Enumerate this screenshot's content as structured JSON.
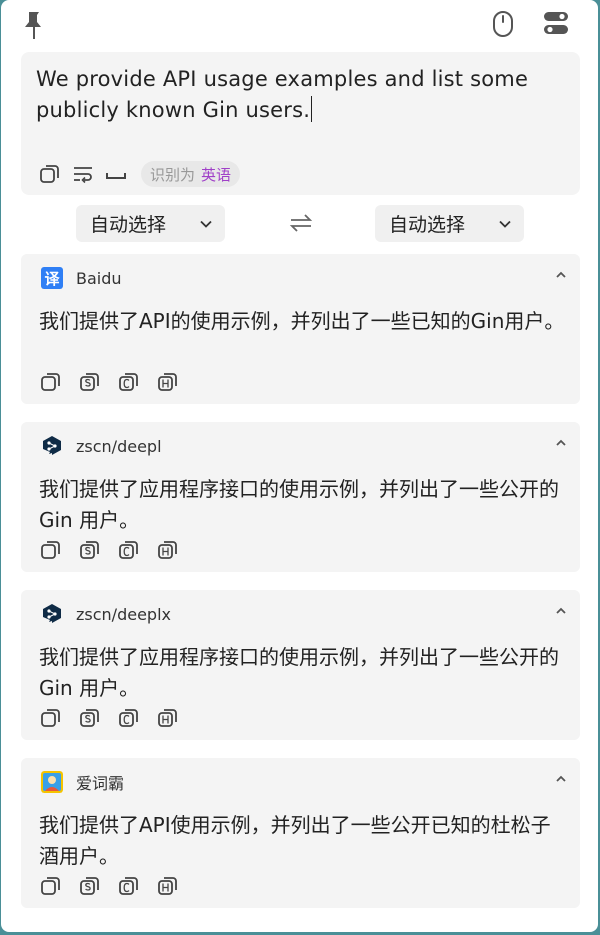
{
  "source": {
    "text": "We provide API usage examples and list some publicly known Gin users.",
    "detected_prefix": "识别为",
    "detected_lang": "英语"
  },
  "languages": {
    "from": "自动选择",
    "to": "自动选择"
  },
  "results": [
    {
      "service": "Baidu",
      "icon": "baidu-translate-icon",
      "icon_glyph": "译",
      "text": "我们提供了API的使用示例，并列出了一些已知的Gin用户。"
    },
    {
      "service": "zscn/deepl",
      "icon": "deepl-icon",
      "text": "我们提供了应用程序接口的使用示例，并列出了一些公开的 Gin 用户。"
    },
    {
      "service": "zscn/deeplx",
      "icon": "deepl-icon",
      "text": "我们提供了应用程序接口的使用示例，并列出了一些公开的 Gin 用户。"
    },
    {
      "service": "爱词霸",
      "icon": "iciba-icon",
      "text": "我们提供了API使用示例，并列出了一些公开已知的杜松子酒用户。"
    }
  ],
  "colors": {
    "accent_purple": "#a040c8",
    "baidu_blue": "#2f7ff5",
    "deepl_navy": "#0f2b46"
  }
}
